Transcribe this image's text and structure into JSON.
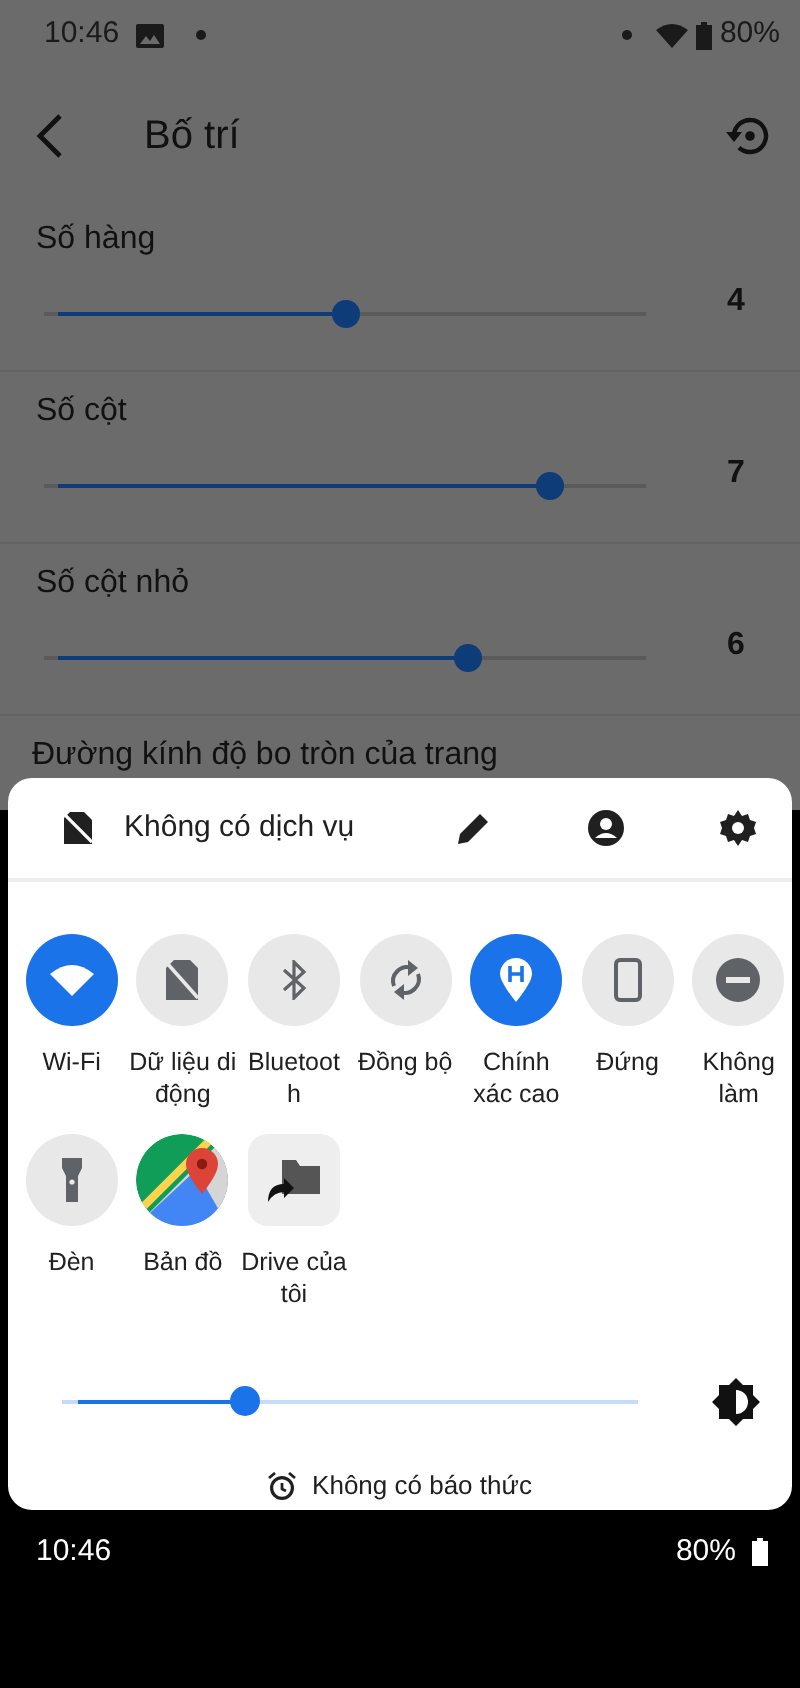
{
  "status_bar": {
    "time": "10:46",
    "battery": "80%"
  },
  "app_bar": {
    "title": "Bố trí"
  },
  "settings": [
    {
      "label": "Số hàng",
      "value": "4",
      "level": 0.5
    },
    {
      "label": "Số cột",
      "value": "7",
      "level": 0.857
    },
    {
      "label": "Số cột nhỏ",
      "value": "6",
      "level": 0.714
    }
  ],
  "next_setting": {
    "label": "Đường kính độ bo tròn của trang"
  },
  "quick_settings": {
    "carrier": "Không có dịch vụ",
    "tiles": [
      {
        "label": "Wi-Fi",
        "kind": "toggle",
        "on": true
      },
      {
        "label": "Dữ liệu di\nđộng",
        "kind": "toggle",
        "on": false
      },
      {
        "label": "Bluetoot\nh",
        "kind": "toggle",
        "on": false
      },
      {
        "label": "Đồng bộ",
        "kind": "toggle",
        "on": false
      },
      {
        "label": "Chính\nxác cao",
        "kind": "toggle",
        "on": true
      },
      {
        "label": "Đứng",
        "kind": "toggle",
        "on": false
      },
      {
        "label": "Không\nlàm",
        "kind": "toggle",
        "on": false
      },
      {
        "label": "Đèn",
        "kind": "toggle",
        "on": false
      },
      {
        "label": "Bản đồ",
        "kind": "shortcut"
      },
      {
        "label": "Drive của\ntôi",
        "kind": "shortcut"
      }
    ],
    "brightness": {
      "level": 0.31
    },
    "alarm": "Không có báo thức"
  },
  "bottom_bar": {
    "time": "10:46",
    "battery": "80%"
  }
}
